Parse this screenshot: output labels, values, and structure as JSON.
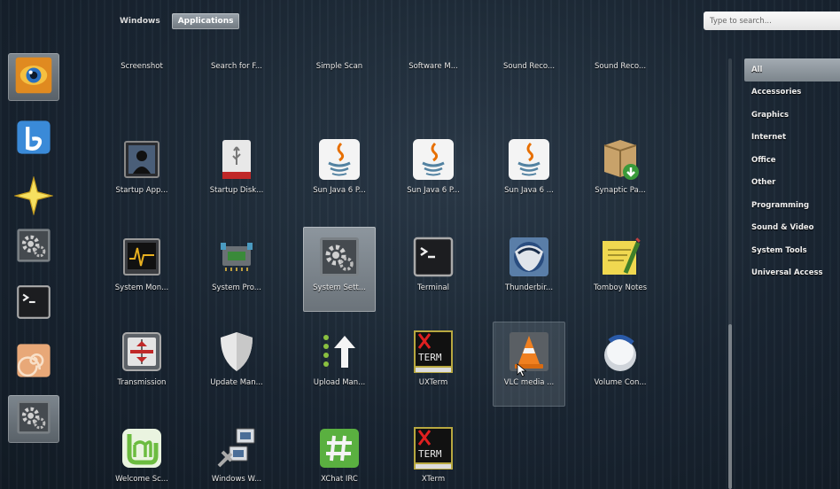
{
  "tabs": [
    {
      "label": "Windows",
      "active": false
    },
    {
      "label": "Applications",
      "active": true
    }
  ],
  "search": {
    "placeholder": "Type to search..."
  },
  "dash": [
    {
      "icon": "eye-of-gnome-icon",
      "running": true
    },
    {
      "icon": "blueman-icon",
      "running": false
    },
    {
      "icon": "star-icon",
      "running": false
    },
    {
      "icon": "system-settings-icon",
      "running": false
    },
    {
      "icon": "terminal-icon",
      "running": false
    },
    {
      "icon": "nautilus-shell-icon",
      "running": false
    },
    {
      "icon": "system-settings-icon",
      "running": true
    }
  ],
  "apps": [
    [
      {
        "label": "Screenshot",
        "icon": "screenshot-icon"
      },
      {
        "label": "Search for F...",
        "icon": "search-files-icon"
      },
      {
        "label": "Simple Scan",
        "icon": "scanner-icon"
      },
      {
        "label": "Software M...",
        "icon": "software-manager-icon"
      },
      {
        "label": "Sound Reco...",
        "icon": "sound-recorder-icon"
      },
      {
        "label": "Sound Reco...",
        "icon": "sound-recorder-alt-icon"
      }
    ],
    [
      {
        "label": "Startup App...",
        "icon": "startup-apps-icon"
      },
      {
        "label": "Startup Disk...",
        "icon": "usb-disk-icon"
      },
      {
        "label": "Sun Java 6 P...",
        "icon": "java-icon"
      },
      {
        "label": "Sun Java 6 P...",
        "icon": "java-icon"
      },
      {
        "label": "Sun Java 6 ...",
        "icon": "java-icon"
      },
      {
        "label": "Synaptic Pa...",
        "icon": "synaptic-package-icon"
      }
    ],
    [
      {
        "label": "System Mon...",
        "icon": "system-monitor-icon"
      },
      {
        "label": "System Pro...",
        "icon": "system-profiler-icon"
      },
      {
        "label": "System Sett...",
        "icon": "system-settings-icon",
        "state": "selected"
      },
      {
        "label": "Terminal",
        "icon": "terminal-icon"
      },
      {
        "label": "Thunderbir...",
        "icon": "thunderbird-icon"
      },
      {
        "label": "Tomboy Notes",
        "icon": "tomboy-notes-icon"
      }
    ],
    [
      {
        "label": "Transmission",
        "icon": "transmission-icon"
      },
      {
        "label": "Update Man...",
        "icon": "shield-icon"
      },
      {
        "label": "Upload Man...",
        "icon": "upload-arrow-icon"
      },
      {
        "label": "UXTerm",
        "icon": "xterm-icon"
      },
      {
        "label": "VLC media ...",
        "icon": "vlc-cone-icon",
        "state": "hover"
      },
      {
        "label": "Volume Con...",
        "icon": "volume-knob-icon"
      }
    ],
    [
      {
        "label": "Welcome Sc...",
        "icon": "mint-welcome-icon"
      },
      {
        "label": "Windows W...",
        "icon": "windows-wireless-icon"
      },
      {
        "label": "XChat IRC",
        "icon": "xchat-icon"
      },
      {
        "label": "XTerm",
        "icon": "xterm-icon"
      }
    ]
  ],
  "categories": [
    {
      "label": "All",
      "active": true
    },
    {
      "label": "Accessories"
    },
    {
      "label": "Graphics"
    },
    {
      "label": "Internet"
    },
    {
      "label": "Office"
    },
    {
      "label": "Other"
    },
    {
      "label": "Programming"
    },
    {
      "label": "Sound & Video"
    },
    {
      "label": "System Tools"
    },
    {
      "label": "Universal Access"
    }
  ],
  "colors": {
    "panel_accent": "#7c858c",
    "background": "#1a2633"
  }
}
